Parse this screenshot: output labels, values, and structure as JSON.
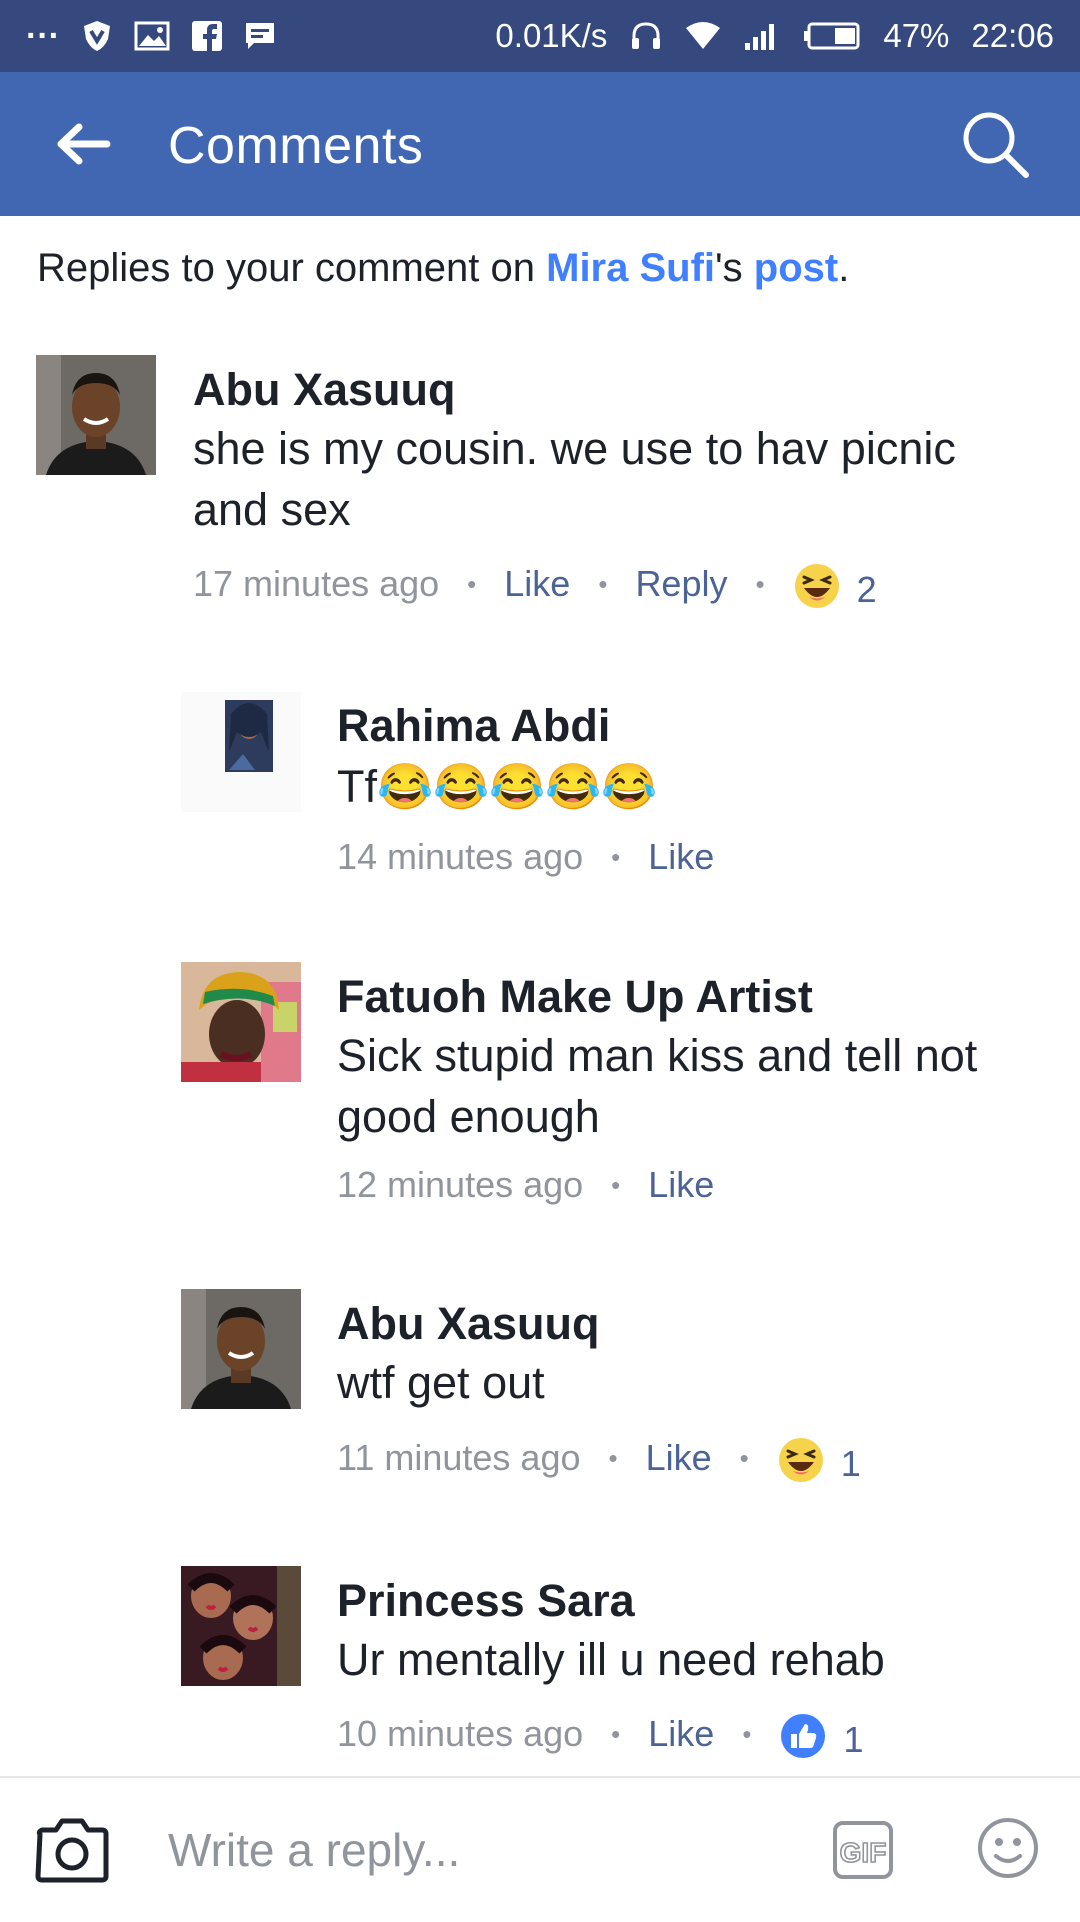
{
  "status_bar": {
    "more": "···",
    "network_speed": "0.01K/s",
    "battery": "47%",
    "time": "22:06"
  },
  "header": {
    "title": "Comments"
  },
  "context": {
    "prefix": "Replies to your comment on ",
    "owner": "Mira Sufi",
    "possessive": "'s ",
    "post": "post",
    "suffix": "."
  },
  "comments": [
    {
      "author": "Abu Xasuuq",
      "text": "she is my cousin. we use to hav picnic and sex",
      "time": "17 minutes ago",
      "like": "Like",
      "reply": "Reply",
      "reaction_icon": "haha",
      "reaction_count": "2"
    },
    {
      "author": "Rahima Abdi",
      "text": "Tf😂😂😂😂😂",
      "time": "14 minutes ago",
      "like": "Like"
    },
    {
      "author": "Fatuoh Make Up Artist",
      "text": "Sick stupid man kiss and tell not good enough",
      "time": "12 minutes ago",
      "like": "Like"
    },
    {
      "author": "Abu Xasuuq",
      "text": "wtf get out",
      "time": "11 minutes ago",
      "like": "Like",
      "reaction_icon": "haha",
      "reaction_count": "1"
    },
    {
      "author": "Princess Sara",
      "text": "Ur mentally ill u need rehab",
      "time": "10 minutes ago",
      "like": "Like",
      "reaction_icon": "like",
      "reaction_count": "1"
    }
  ],
  "composer": {
    "placeholder": "Write a reply...",
    "gif_label": "GIF"
  },
  "colors": {
    "status_bar": "#35497e",
    "app_bar": "#4267b2",
    "link": "#4080ff",
    "action": "#4b6396",
    "muted": "#90949c"
  }
}
